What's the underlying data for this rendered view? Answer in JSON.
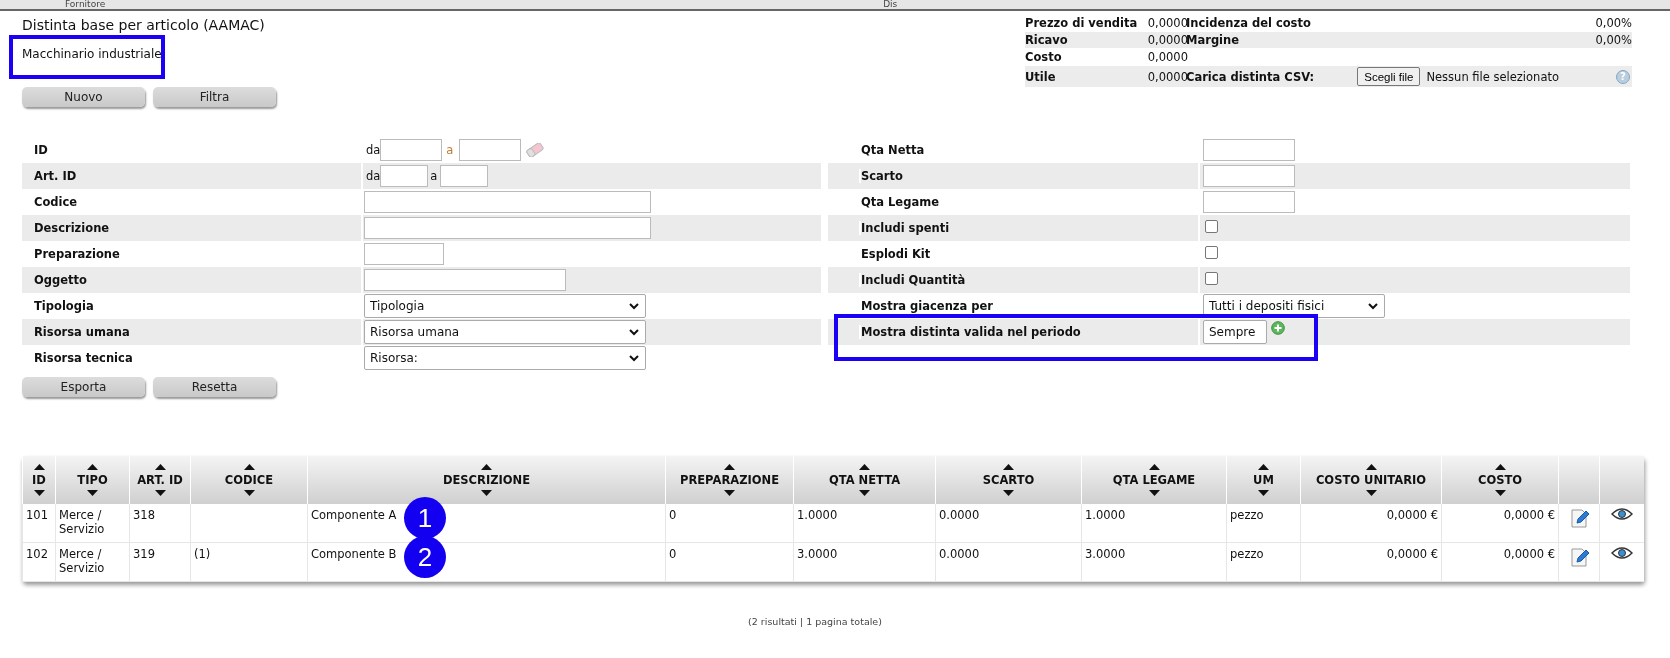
{
  "top_bar": {
    "column_1": "Fornitore",
    "column_2": "Dis"
  },
  "title": "Distinta base per articolo (AAMAC)",
  "subtitle": {
    "text": "Macchinario industriale",
    "highlighted": true
  },
  "summary": [
    {
      "kind": "metric",
      "label": "Prezzo di vendita",
      "value": "0,0000",
      "label_2": "Incidenza del costo",
      "value_2": "0,00%"
    },
    {
      "kind": "metric",
      "label": "Ricavo",
      "value": "0,0000",
      "label_2": "Margine",
      "value_2": "0,00%"
    },
    {
      "kind": "metric",
      "label": "Costo",
      "value": "0,0000"
    },
    {
      "kind": "upload",
      "label": "Utile",
      "value": "0,0000",
      "label_2": "Carica distinta CSV:",
      "button": "Scegli file",
      "status": "Nessun file selezionato",
      "help": "?"
    }
  ],
  "top_buttons": [
    "Nuovo",
    "Filtra"
  ],
  "filters_left": [
    {
      "kind": "range",
      "label": "ID",
      "from": "da",
      "to": "a",
      "clearable": true,
      "highlighted": false
    },
    {
      "kind": "range",
      "label": "Art. ID",
      "from": "da",
      "to": "a",
      "clearable": false,
      "highlighted": false
    },
    {
      "kind": "text",
      "label": "Codice",
      "highlighted": false
    },
    {
      "kind": "text",
      "label": "Descrizione",
      "highlighted": false
    },
    {
      "kind": "text",
      "label": "Preparazione",
      "highlighted": false
    },
    {
      "kind": "text",
      "label": "Oggetto",
      "highlighted": false
    },
    {
      "kind": "select",
      "label": "Tipologia",
      "value": "Tipologia",
      "addable": false,
      "highlighted": false
    },
    {
      "kind": "select",
      "label": "Risorsa umana",
      "value": "Risorsa umana",
      "addable": false,
      "highlighted": false
    },
    {
      "kind": "select",
      "label": "Risorsa tecnica",
      "value": "Risorsa:",
      "addable": false,
      "highlighted": false
    }
  ],
  "filters_right": [
    {
      "kind": "text",
      "label": "Qta Netta",
      "highlighted": false
    },
    {
      "kind": "text",
      "label": "Scarto",
      "highlighted": false
    },
    {
      "kind": "text",
      "label": "Qta Legame",
      "highlighted": false
    },
    {
      "kind": "checkbox",
      "label": "Includi spenti",
      "checked": false,
      "highlighted": false
    },
    {
      "kind": "checkbox",
      "label": "Esplodi Kit",
      "checked": false,
      "highlighted": false
    },
    {
      "kind": "checkbox",
      "label": "Includi Quantità",
      "checked": false,
      "highlighted": false
    },
    {
      "kind": "select",
      "label": "Mostra giacenza per",
      "value": "Tutti i depositi fisici",
      "addable": false,
      "highlighted": false
    },
    {
      "kind": "select",
      "label": "Mostra distinta valida nel periodo",
      "value": "Sempre",
      "addable": true,
      "highlighted": true
    }
  ],
  "bottom_buttons": [
    "Esporta",
    "Resetta"
  ],
  "table": {
    "columns": [
      "ID",
      "TIPO",
      "ART. ID",
      "CODICE",
      "DESCRIZIONE",
      "PREPARAZIONE",
      "QTA NETTA",
      "SCARTO",
      "QTA LEGAME",
      "UM",
      "COSTO UNITARIO",
      "COSTO"
    ],
    "rows": [
      {
        "cells": [
          "101",
          "Merce / Servizio",
          "318",
          null,
          "Componente A",
          "0",
          "1.0000",
          "0.0000",
          "1.0000",
          "pezzo",
          "0,0000 €",
          "0,0000 €"
        ],
        "marker": "1"
      },
      {
        "cells": [
          "102",
          "Merce / Servizio",
          "319",
          "(1)",
          "Componente B",
          "0",
          "3.0000",
          "0.0000",
          "3.0000",
          "pezzo",
          "0,0000 €",
          "0,0000 €"
        ],
        "marker": "2"
      }
    ]
  },
  "pagination": "(2 risultati | 1 pagina totale)"
}
